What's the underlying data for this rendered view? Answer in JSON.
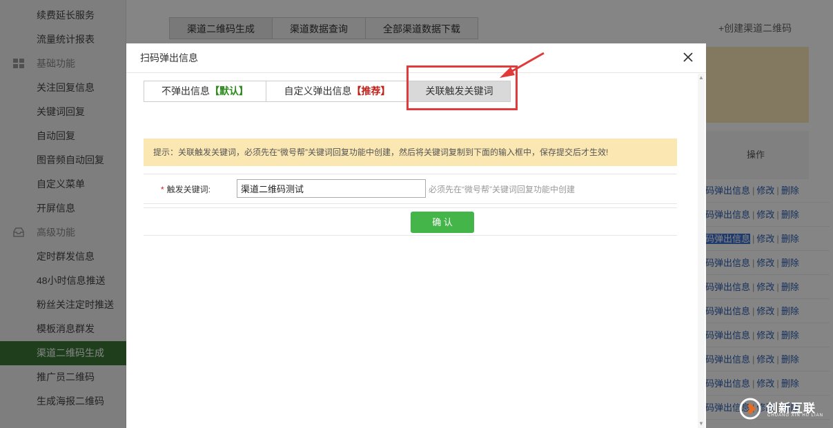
{
  "sidebar": {
    "items": [
      {
        "type": "item",
        "label": "续费延长服务"
      },
      {
        "type": "item",
        "label": "流量统计报表"
      },
      {
        "type": "group",
        "label": "基础功能",
        "icon": "grid-icon"
      },
      {
        "type": "item",
        "label": "关注回复信息"
      },
      {
        "type": "item",
        "label": "关键词回复"
      },
      {
        "type": "item",
        "label": "自动回复"
      },
      {
        "type": "item",
        "label": "图音频自动回复"
      },
      {
        "type": "item",
        "label": "自定义菜单"
      },
      {
        "type": "item",
        "label": "开屏信息"
      },
      {
        "type": "group",
        "label": "高级功能",
        "icon": "inbox-icon"
      },
      {
        "type": "item",
        "label": "定时群发信息"
      },
      {
        "type": "item",
        "label": "48小时信息推送"
      },
      {
        "type": "item",
        "label": "粉丝关注定时推送"
      },
      {
        "type": "item",
        "label": "模板消息群发"
      },
      {
        "type": "item",
        "label": "渠道二维码生成",
        "active": true
      },
      {
        "type": "item",
        "label": "推广员二维码"
      },
      {
        "type": "item",
        "label": "生成海报二维码"
      }
    ]
  },
  "main": {
    "tabs": [
      "渠道二维码生成",
      "渠道数据查询",
      "全部渠道数据下载"
    ],
    "create_link": "+创建渠道二维码",
    "table": {
      "op_header": "操作",
      "rows": [
        {
          "a": "码弹出信息",
          "b": "修改",
          "c": "删除"
        },
        {
          "a": "码弹出信息",
          "b": "修改",
          "c": "删除"
        },
        {
          "a": "码弹出信息",
          "b": "修改",
          "c": "删除",
          "highlight": true
        },
        {
          "a": "码弹出信息",
          "b": "修改",
          "c": "删除"
        },
        {
          "a": "码弹出信息",
          "b": "修改",
          "c": "删除"
        },
        {
          "a": "码弹出信息",
          "b": "修改",
          "c": "删除"
        },
        {
          "a": "码弹出信息",
          "b": "修改",
          "c": "删除"
        },
        {
          "a": "码弹出信息",
          "b": "修改",
          "c": "删除"
        },
        {
          "a": "码弹出信息",
          "b": "修改",
          "c": "删除"
        },
        {
          "a": "码弹出信息",
          "b": "修改",
          "c": "删除"
        }
      ],
      "separator": "|"
    }
  },
  "modal": {
    "title": "扫码弹出信息",
    "close_icon": "close-icon",
    "tabs": {
      "t1_label": "不弹出信息",
      "t1_tag": "【默认】",
      "t2_label": "自定义弹出信息",
      "t2_tag": "【推荐】",
      "t3_label": "关联触发关键词"
    },
    "hint": "提示：关联触发关键词，必须先在“微号帮”关键词回复功能中创建，然后将关键词复制到下面的输入框中，保存提交后才生效!",
    "field": {
      "required_mark": "*",
      "label": "触发关键词:",
      "value": "渠道二维码测试",
      "help": "必须先在“微号帮”关键词回复功能中创建"
    },
    "confirm_label": "确 认"
  },
  "colors": {
    "confirm_green": "#44b549",
    "annotation_red": "#e03a3a",
    "hint_bg": "#fbe7b2",
    "sidebar_active": "#3c7a36"
  },
  "watermark": {
    "name": "创新互联",
    "sub": "CHUANG XIN HU LIAN"
  }
}
